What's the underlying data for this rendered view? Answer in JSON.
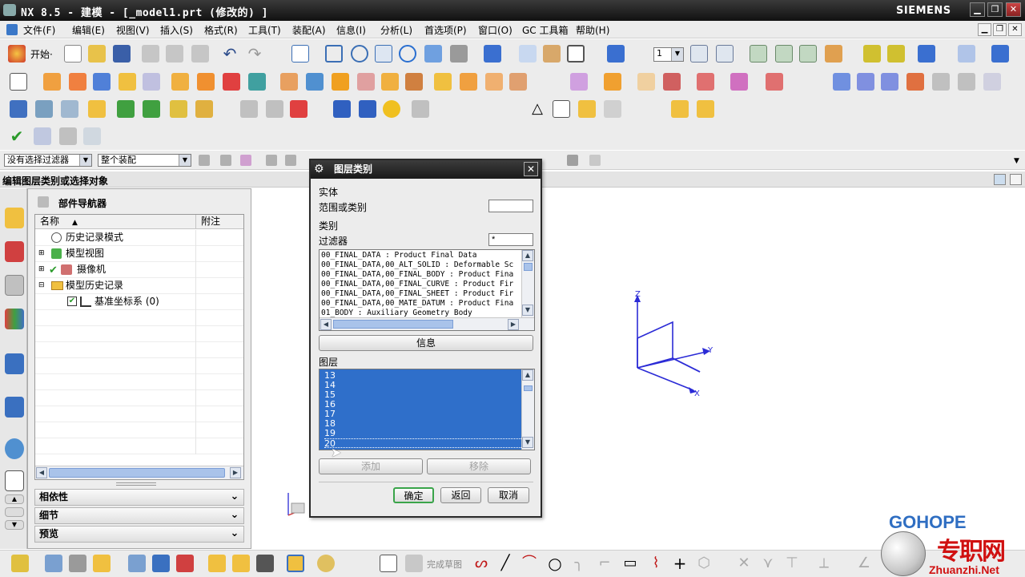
{
  "window": {
    "title": "NX 8.5 - 建模 - [_model1.prt  (修改的) ]",
    "brand": "SIEMENS",
    "controls": [
      "▁",
      "❐",
      "✕"
    ]
  },
  "menu": {
    "items": [
      "文件(F)",
      "编辑(E)",
      "视图(V)",
      "插入(S)",
      "格式(R)",
      "工具(T)",
      "装配(A)",
      "信息(I)",
      "分析(L)",
      "首选项(P)",
      "窗口(O)",
      "GC 工具箱",
      "帮助(H)"
    ]
  },
  "toolbar": {
    "start_label": "开始·",
    "layer_value": "1",
    "finish_sketch_label": "完成草图"
  },
  "selection": {
    "filter_value": "没有选择过滤器",
    "scope_value": "整个装配"
  },
  "status": {
    "message": "编辑图层类别或选择对象"
  },
  "navigator": {
    "title": "部件导航器",
    "columns": {
      "name": "名称",
      "note": "附注"
    },
    "nodes": [
      {
        "label": "历史记录模式",
        "icon": "clock-icon"
      },
      {
        "label": "模型视图",
        "icon": "views-icon"
      },
      {
        "label": "摄像机",
        "icon": "camera-icon"
      },
      {
        "label": "模型历史记录",
        "icon": "folder-icon"
      },
      {
        "label": "基准坐标系 (0)",
        "icon": "csys-icon"
      }
    ],
    "sections": [
      "相依性",
      "细节",
      "预览"
    ]
  },
  "dialog": {
    "title": "图层类别",
    "entity_group": "实体",
    "range_label": "范围或类别",
    "range_value": "",
    "category_group": "类别",
    "filter_label": "过滤器",
    "filter_value": "*",
    "categories": [
      "00_FINAL_DATA : Product Final Data",
      "00_FINAL_DATA,00_ALT_SOLID : Deformable Sc",
      "00_FINAL_DATA,00_FINAL_BODY : Product Fina",
      "00_FINAL_DATA,00_FINAL_CURVE : Product Fir",
      "00_FINAL_DATA,00_FINAL_SHEET : Product Fir",
      "00_FINAL_DATA,00_MATE_DATUM : Product Fina",
      "01_BODY : Auxiliary Geometry Body"
    ],
    "info_button": "信息",
    "layer_group": "图层",
    "layers": [
      "13",
      "14",
      "15",
      "16",
      "17",
      "18",
      "19",
      "20"
    ],
    "add_button": "添加",
    "remove_button": "移除",
    "ok_button": "确定",
    "back_button": "返回",
    "cancel_button": "取消"
  },
  "triad": {
    "x": "X",
    "y": "Y",
    "z": "Z"
  },
  "watermark": {
    "brand": "GOHOPE",
    "cn": "专职网",
    "url": "Zhuanzhi.Net"
  },
  "colors": {
    "accent": "#2f6fca",
    "titlebar": "#1a1a1a",
    "triad": "#2b2bd6",
    "ok_border": "#3aa44a"
  }
}
